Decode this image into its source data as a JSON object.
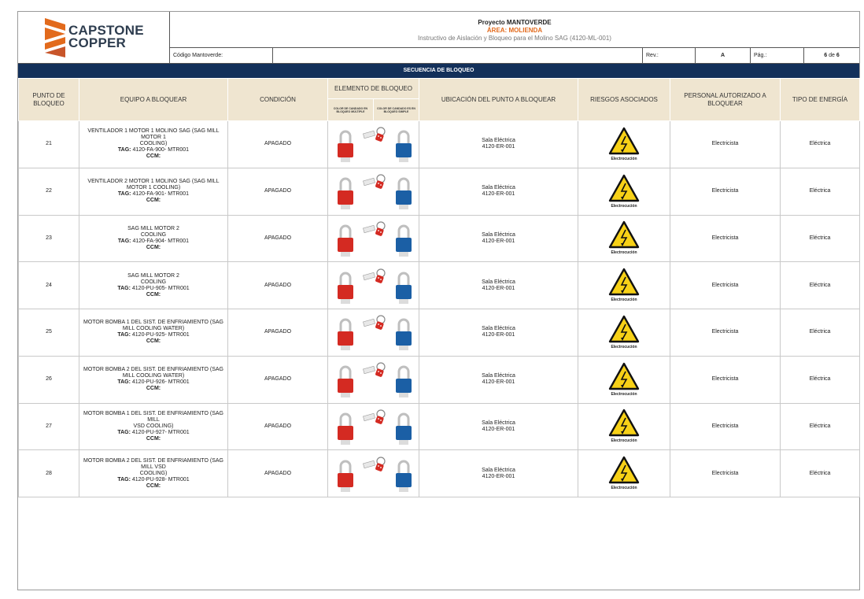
{
  "header": {
    "logo_line1": "CAPSTONE",
    "logo_line2": "COPPER",
    "project": "Proyecto MANTOVERDE",
    "area": "ÁREA: MOLIENDA",
    "instructivo": "Instructivo de Aislación y Bloqueo para el Molino SAG (4120-ML-001)",
    "codigo_label": "Código Mantoverde:",
    "codigo_value": "",
    "rev_label": "Rev.:",
    "rev_value": "A",
    "pag_label": "Pág.:",
    "pag_current": "6",
    "pag_de": "de",
    "pag_total": "6"
  },
  "sequence_title": "SECUENCIA DE BLOQUEO",
  "columns": {
    "punto": "PUNTO DE BLOQUEO",
    "equipo": "EQUIPO A BLOQUEAR",
    "condicion": "CONDICIÓN",
    "elemento": "ELEMENTO DE BLOQUEO",
    "elemento_multiple": "COLOR DE CANDADO EN BLOQUEO MÚLTIPLE",
    "elemento_simple": "COLOR DE CANDADO ES EN BLOQUEO SIMPLE",
    "ubicacion": "UBICACIÓN DEL PUNTO A BLOQUEAR",
    "riesgos": "RIESGOS ASOCIADOS",
    "personal": "PERSONAL AUTORIZADO A BLOQUEAR",
    "tipo": "TIPO DE ENERGÍA"
  },
  "colors": {
    "header_bar": "#13305a",
    "column_header_bg": "#efe5d0",
    "area_orange": "#e26a1c",
    "lock_red": "#d42a22",
    "lock_blue": "#1b5fa5",
    "warning_yellow": "#f7d117"
  },
  "icons": {
    "red_lock": "red-padlock-icon",
    "blue_lock": "blue-padlock-icon",
    "hasp": "lockout-hasp-icon",
    "risk": "electrical-hazard-warning-icon"
  },
  "rows": [
    {
      "punto": "21",
      "equipo_lines": [
        "VENTILADOR 1 MOTOR 1 MOLINO SAG (SAG MILL",
        "MOTOR 1",
        "COOLING)"
      ],
      "tag_label": "TAG:",
      "tag_value": "4120-FA-900- MTR001",
      "ccm": "CCM:",
      "condicion": "APAGADO",
      "ubicacion_1": "Sala Eléctrica",
      "ubicacion_2": "4120-ER-001",
      "riesgo": "Electrocución",
      "personal": "Electricista",
      "tipo": "Eléctrica"
    },
    {
      "punto": "22",
      "equipo_lines": [
        "VENTILADOR 2 MOTOR 1 MOLINO SAG (SAG MILL",
        "MOTOR 1 COOLING)"
      ],
      "tag_label": "TAG:",
      "tag_value": "4120-FA-901- MTR001",
      "ccm": "CCM:",
      "condicion": "APAGADO",
      "ubicacion_1": "Sala Eléctrica",
      "ubicacion_2": "4120-ER-001",
      "riesgo": "Electrocución",
      "personal": "Electricista",
      "tipo": "Eléctrica"
    },
    {
      "punto": "23",
      "equipo_lines": [
        "SAG MILL MOTOR 2",
        "COOLING"
      ],
      "tag_label": "TAG:",
      "tag_value": "4120-FA-904- MTR001",
      "ccm": "CCM:",
      "condicion": "APAGADO",
      "ubicacion_1": "Sala Eléctrica",
      "ubicacion_2": "4120-ER-001",
      "riesgo": "Electrocución",
      "personal": "Electricista",
      "tipo": "Eléctrica"
    },
    {
      "punto": "24",
      "equipo_lines": [
        "SAG MILL MOTOR 2",
        "COOLING"
      ],
      "tag_label": "TAG:",
      "tag_value": "4120-PU-905- MTR001",
      "ccm": "CCM:",
      "condicion": "APAGADO",
      "ubicacion_1": "Sala Eléctrica",
      "ubicacion_2": "4120-ER-001",
      "riesgo": "Electrocución",
      "personal": "Electricista",
      "tipo": "Eléctrica"
    },
    {
      "punto": "25",
      "equipo_lines": [
        "MOTOR BOMBA 1 DEL SIST. DE ENFRIAMIENTO (SAG",
        "MILL COOLING WATER)"
      ],
      "tag_label": "TAG:",
      "tag_value": "4120-PU-925- MTR001",
      "ccm": "CCM:",
      "condicion": "APAGADO",
      "ubicacion_1": "Sala Eléctrica",
      "ubicacion_2": "4120-ER-001",
      "riesgo": "Electrocución",
      "personal": "Electricista",
      "tipo": "Eléctrica"
    },
    {
      "punto": "26",
      "equipo_lines": [
        "MOTOR BOMBA 2 DEL SIST. DE ENFRIAMIENTO (SAG",
        "MILL COOLING WATER)"
      ],
      "tag_label": "TAG:",
      "tag_value": "4120-PU-926- MTR001",
      "ccm": "CCM:",
      "condicion": "APAGADO",
      "ubicacion_1": "Sala Eléctrica",
      "ubicacion_2": "4120-ER-001",
      "riesgo": "Electrocución",
      "personal": "Electricista",
      "tipo": "Eléctrica"
    },
    {
      "punto": "27",
      "equipo_lines": [
        "MOTOR BOMBA 1 DEL SIST. DE ENFRIAMIENTO (SAG",
        "MILL",
        "VSD COOLING)"
      ],
      "tag_label": "TAG:",
      "tag_value": "4120-PU-927- MTR001",
      "ccm": "CCM:",
      "condicion": "APAGADO",
      "ubicacion_1": "Sala Eléctrica",
      "ubicacion_2": "4120-ER-001",
      "riesgo": "Electrocución",
      "personal": "Electricista",
      "tipo": "Eléctrica"
    },
    {
      "punto": "28",
      "equipo_lines": [
        "MOTOR BOMBA 2 DEL SIST. DE ENFRIAMIENTO (SAG",
        "MILL VSD",
        "COOLING)"
      ],
      "tag_label": "TAG:",
      "tag_value": "4120-PU-928- MTR001",
      "ccm": "CCM:",
      "condicion": "APAGADO",
      "ubicacion_1": "Sala Eléctrica",
      "ubicacion_2": "4120-ER-001",
      "riesgo": "Electrocución",
      "personal": "Electricista",
      "tipo": "Eléctrica"
    }
  ]
}
